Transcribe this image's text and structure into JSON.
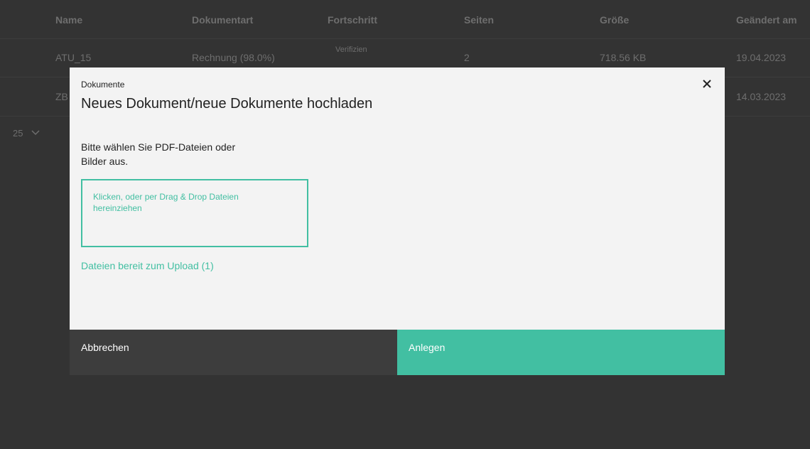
{
  "background_table": {
    "columns": [
      "Name",
      "Dokumentart",
      "Fortschritt",
      "Seiten",
      "Größe",
      "Geändert am"
    ],
    "rows": [
      {
        "name": "ATU_15",
        "type": "Rechnung (98.0%)",
        "progress": "Verifizien",
        "pages": "2",
        "size": "718.56 KB",
        "date": "19.04.2023"
      },
      {
        "name": "ZB",
        "type": "",
        "progress": "",
        "pages": "",
        "size": "",
        "date": "14.03.2023"
      }
    ],
    "page_size": "25"
  },
  "modal": {
    "label": "Dokumente",
    "title": "Neues Dokument/neue Dokumente hochladen",
    "instructions": "Bitte wählen Sie PDF-Dateien oder Bilder aus.",
    "dropzone_text": "Klicken, oder per Drag & Drop Dateien hereinziehen",
    "ready_link": "Dateien bereit zum Upload (1)",
    "cancel_label": "Abbrechen",
    "create_label": "Anlegen"
  },
  "colors": {
    "accent": "#42bfa2",
    "overlay": "#333333",
    "cancel_bg": "#3d3d3d"
  },
  "icons": {
    "close": "close-icon",
    "page_size_dropdown": "chevron-down-icon"
  }
}
